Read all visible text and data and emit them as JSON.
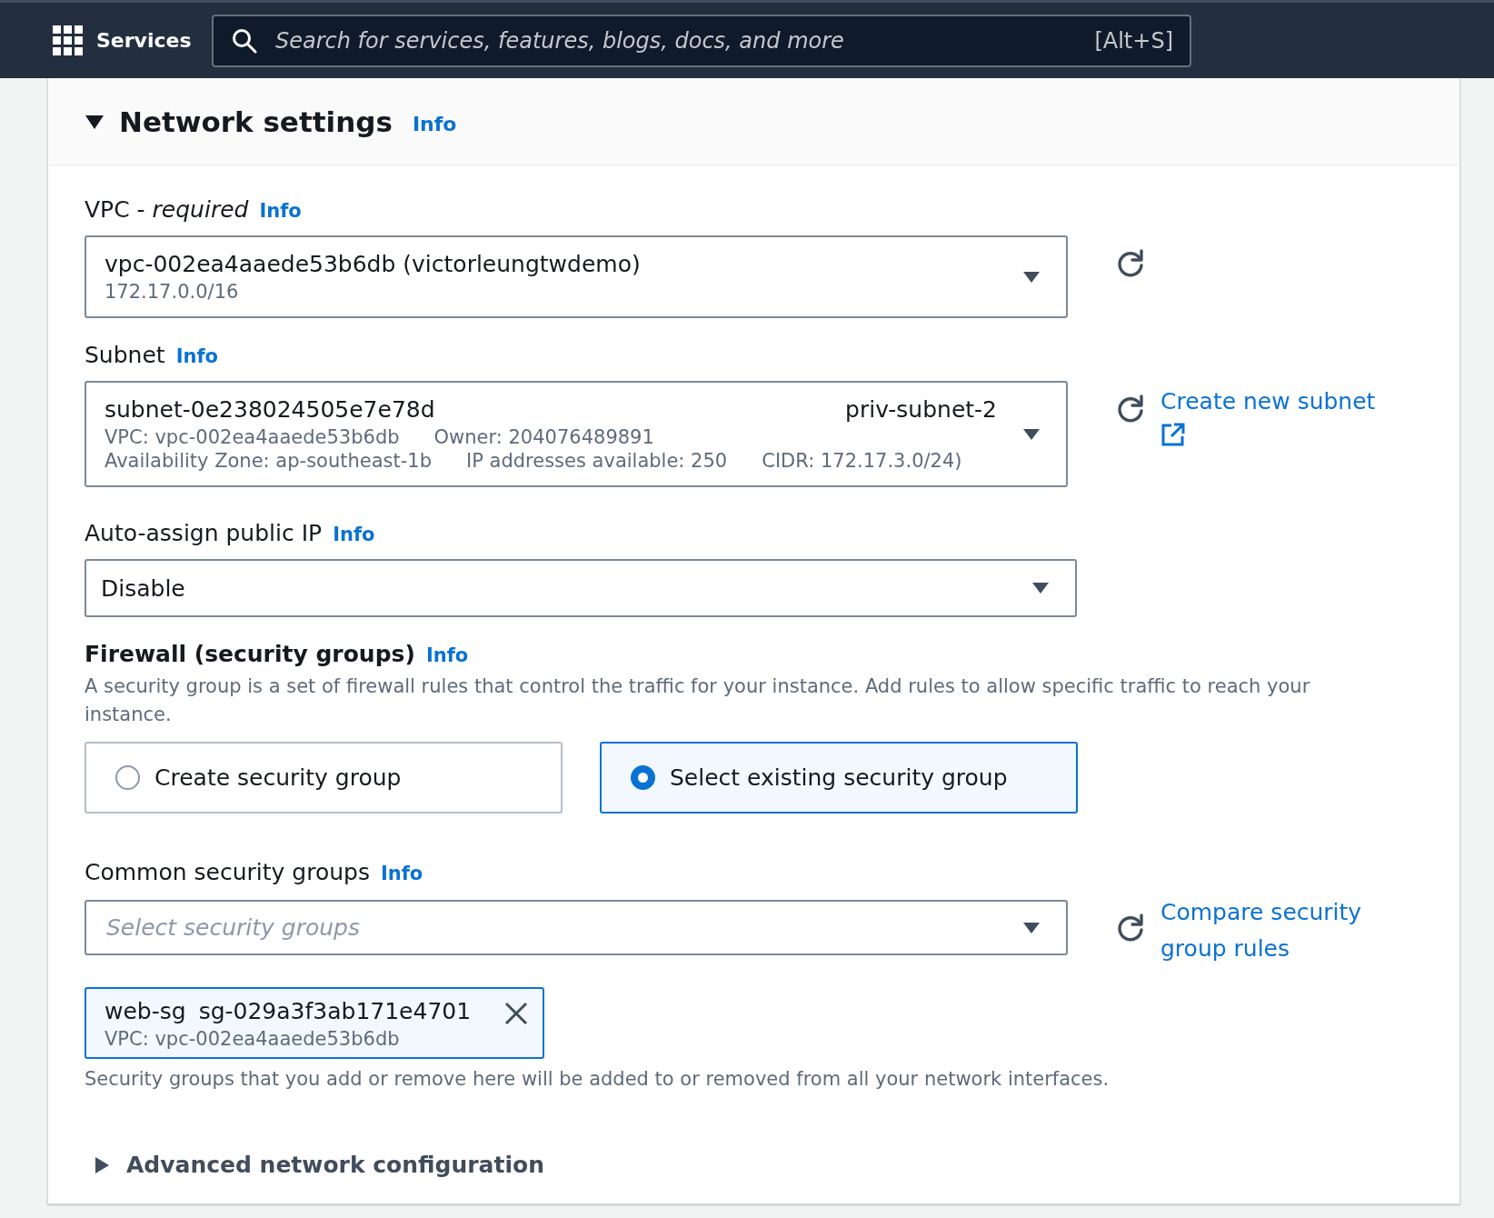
{
  "top_nav": {
    "services_label": "Services",
    "search": {
      "placeholder": "Search for services, features, blogs, docs, and more",
      "shortcut": "[Alt+S]"
    }
  },
  "section": {
    "title": "Network settings",
    "info": "Info",
    "expanded": true
  },
  "vpc": {
    "label": "VPC - *required*",
    "info": "Info",
    "value": "vpc-002ea4aaede53b6db (victorleungtwdemo)",
    "details": [
      [
        "172.17.0.0/16"
      ]
    ]
  },
  "subnet": {
    "label": "Subnet",
    "info": "Info",
    "value": "subnet-0e238024505e7e78d",
    "tag": "priv-subnet-2",
    "details": [
      [
        "VPC: vpc-002ea4aaede53b6db",
        "Owner: 204076489891"
      ],
      [
        "Availability Zone: ap-southeast-1b",
        "IP addresses available: 250",
        "CIDR: 172.17.3.0/24)"
      ]
    ],
    "link": "Create new subnet"
  },
  "auto_assign_ip": {
    "label": "Auto-assign public IP",
    "info": "Info",
    "value": "Disable"
  },
  "firewall": {
    "heading": "Firewall (security groups)",
    "info": "Info",
    "description": "A security group is a set of firewall rules that control the traffic for your instance. Add rules to allow specific traffic to reach your instance.",
    "options": [
      {
        "label": "Create security group",
        "selected": false
      },
      {
        "label": "Select existing security group",
        "selected": true
      }
    ]
  },
  "common_security_groups": {
    "label": "Common security groups",
    "info": "Info",
    "placeholder": "Select security groups",
    "link": "Compare security group rules",
    "tokens": [
      {
        "name": "web-sg",
        "id": "sg-029a3f3ab171e4701",
        "detail": "VPC: vpc-002ea4aaede53b6db"
      }
    ],
    "hint": "Security groups that you add or remove here will be added to or removed from all your network interfaces."
  },
  "advanced": {
    "label": "Advanced network configuration",
    "expanded": false
  }
}
